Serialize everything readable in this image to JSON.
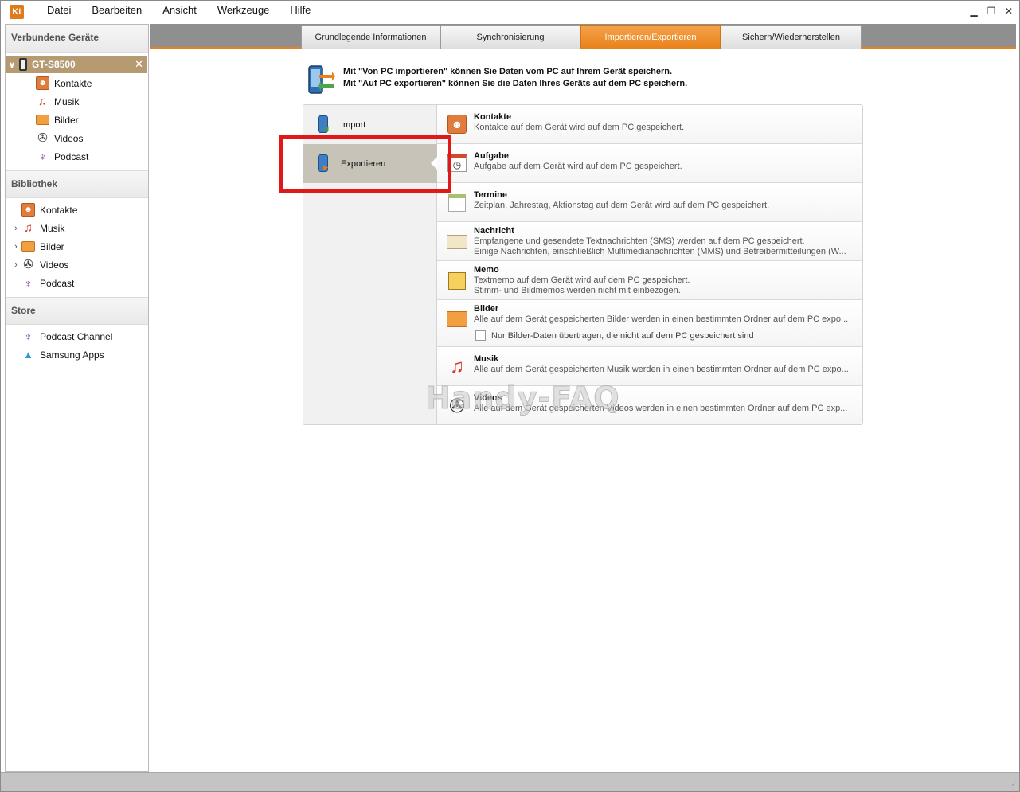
{
  "menu": {
    "logo": "Kt",
    "items": [
      "Datei",
      "Bearbeiten",
      "Ansicht",
      "Werkzeuge",
      "Hilfe"
    ],
    "window_controls": [
      "minimize-icon",
      "restore-icon",
      "close-icon"
    ]
  },
  "sidebar": {
    "connected": {
      "heading": "Verbundene Geräte",
      "device_name": "GT-S8500",
      "items": [
        "Kontakte",
        "Musik",
        "Bilder",
        "Videos",
        "Podcast"
      ]
    },
    "library": {
      "heading": "Bibliothek",
      "items": [
        "Kontakte",
        "Musik",
        "Bilder",
        "Videos",
        "Podcast"
      ]
    },
    "store": {
      "heading": "Store",
      "items": [
        "Podcast Channel",
        "Samsung Apps"
      ]
    }
  },
  "tabs": [
    {
      "label": "Grundlegende Informationen",
      "active": false
    },
    {
      "label": "Synchronisierung",
      "active": false
    },
    {
      "label": "Importieren/Exportieren",
      "active": true
    },
    {
      "label": "Sichern/Wiederherstellen",
      "active": false
    }
  ],
  "info": {
    "line1": "Mit \"Von PC importieren\" können Sie Daten vom PC auf Ihrem Gerät speichern.",
    "line2": "Mit \"Auf PC exportieren\" können Sie die Daten Ihres Geräts auf dem PC speichern."
  },
  "modes": {
    "import_label": "Import",
    "export_label": "Exportieren",
    "selected": "Exportieren"
  },
  "export_rows": [
    {
      "icon": "contact-icon",
      "title": "Kontakte",
      "desc": [
        "Kontakte auf dem Gerät wird auf dem PC gespeichert."
      ]
    },
    {
      "icon": "task-icon",
      "title": "Aufgabe",
      "desc": [
        "Aufgabe auf dem Gerät wird auf dem PC gespeichert."
      ]
    },
    {
      "icon": "calendar-icon",
      "title": "Termine",
      "desc": [
        "Zeitplan, Jahrestag, Aktionstag auf dem Gerät wird auf dem PC gespeichert."
      ]
    },
    {
      "icon": "mail-icon",
      "title": "Nachricht",
      "desc": [
        "Empfangene und gesendete Textnachrichten (SMS) werden auf dem PC gespeichert.",
        "Einige Nachrichten, einschließlich Multimedianachrichten (MMS) und Betreibermitteilungen (W..."
      ]
    },
    {
      "icon": "memo-icon",
      "title": "Memo",
      "desc": [
        "Textmemo auf dem Gerät wird auf dem PC gespeichert.",
        "Stimm- und Bildmemos werden nicht mit einbezogen."
      ]
    },
    {
      "icon": "pictures-icon",
      "title": "Bilder",
      "desc": [
        "Alle auf dem Gerät gespeicherten Bilder werden in einen bestimmten Ordner auf dem PC expo..."
      ],
      "checkbox": "Nur Bilder-Daten übertragen, die nicht auf dem PC gespeichert sind",
      "checked": false
    },
    {
      "icon": "music-icon",
      "title": "Musik",
      "desc": [
        "Alle auf dem Gerät gespeicherten Musik werden in einen bestimmten Ordner auf dem PC expo..."
      ]
    },
    {
      "icon": "video-icon",
      "title": "Videos",
      "desc": [
        "Alle auf dem Gerät gespeicherten Videos werden in einen bestimmten Ordner auf dem PC exp..."
      ]
    }
  ],
  "watermark": "Handy-FAQ",
  "colors": {
    "accent": "#e9821a",
    "device_highlight": "#b59a72",
    "selected_mode": "#c7c3b8",
    "annotation_box": "#e01818"
  }
}
